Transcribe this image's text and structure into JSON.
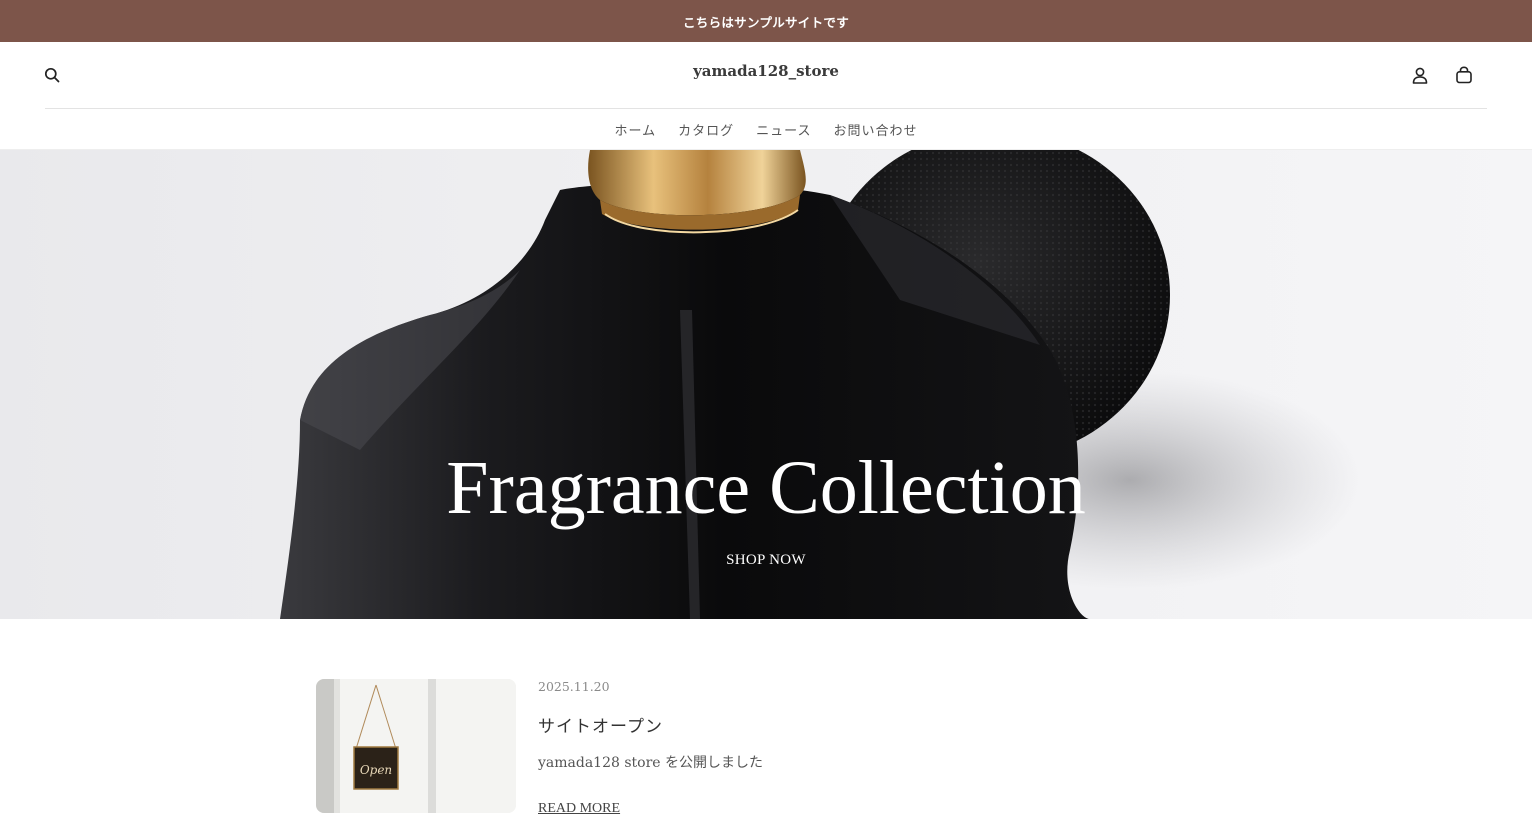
{
  "announcement": {
    "text": "こちらはサンプルサイトです"
  },
  "header": {
    "logo": "yamada128_store",
    "icons": {
      "search": "search-icon",
      "account": "account-icon",
      "cart": "cart-icon"
    },
    "nav": [
      {
        "label": "ホーム"
      },
      {
        "label": "カタログ"
      },
      {
        "label": "ニュース"
      },
      {
        "label": "お問い合わせ"
      }
    ]
  },
  "hero": {
    "title": "Fragrance Collection",
    "cta": "SHOP NOW"
  },
  "news": {
    "items": [
      {
        "date": "2025.11.20",
        "title": "サイトオープン",
        "excerpt": "yamada128 store を公開しました",
        "link": "READ MORE",
        "sign_text": "Open"
      }
    ]
  },
  "colors": {
    "announcement_bg": "#7d554a",
    "text": "#3a3a3a",
    "hero_bottle": "#0d0d0f",
    "bottle_cap": "#c8924e"
  }
}
